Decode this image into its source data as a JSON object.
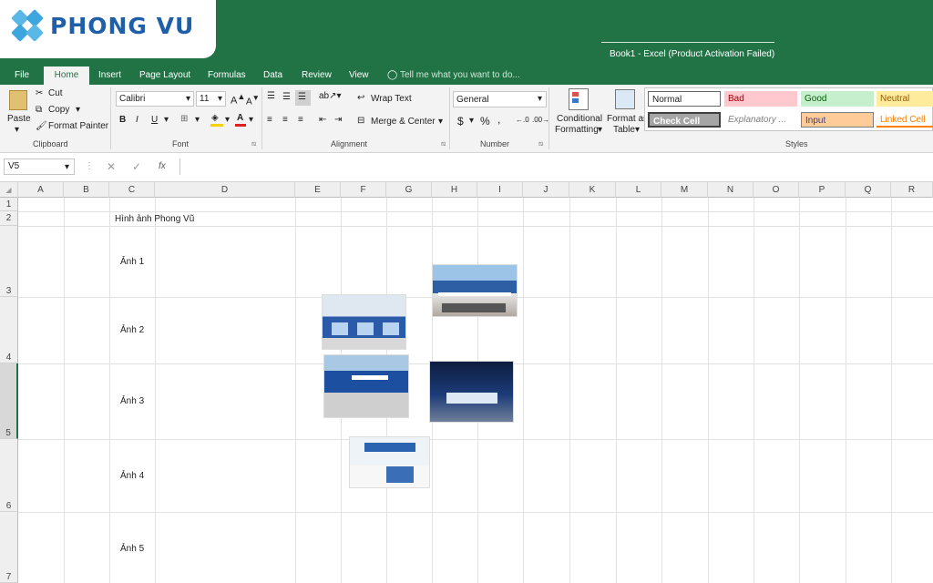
{
  "brand": {
    "logo_text": "PHONG VU"
  },
  "window": {
    "title": "Book1 - Excel (Product Activation Failed)"
  },
  "menu": {
    "tabs": [
      "File",
      "Home",
      "Insert",
      "Page Layout",
      "Formulas",
      "Data",
      "Review",
      "View"
    ],
    "tell_me": "Tell me what you want to do..."
  },
  "ribbon": {
    "clipboard": {
      "paste": "Paste",
      "cut": "Cut",
      "copy": "Copy",
      "format_painter": "Format Painter",
      "group": "Clipboard"
    },
    "font": {
      "name": "Calibri",
      "size": "11",
      "group": "Font"
    },
    "alignment": {
      "wrap_text": "Wrap Text",
      "merge_center": "Merge & Center",
      "group": "Alignment"
    },
    "number": {
      "format": "General",
      "group": "Number"
    },
    "styles": {
      "conditional_formatting_1": "Conditional",
      "conditional_formatting_2": "Formatting",
      "format_as_table_1": "Format as",
      "format_as_table_2": "Table",
      "normal": "Normal",
      "bad": "Bad",
      "good": "Good",
      "neutral": "Neutral",
      "check_cell": "Check Cell",
      "explanatory": "Explanatory ...",
      "input": "Input",
      "linked_cell": "Linked Cell",
      "group": "Styles"
    }
  },
  "formula_bar": {
    "name_box": "V5",
    "fx": "fx",
    "content": ""
  },
  "columns": [
    "A",
    "B",
    "C",
    "D",
    "E",
    "F",
    "G",
    "H",
    "I",
    "J",
    "K",
    "L",
    "M",
    "N",
    "O",
    "P",
    "Q",
    "R"
  ],
  "rows": [
    "1",
    "2",
    "3",
    "4",
    "5",
    "6",
    "7"
  ],
  "cells": {
    "c2": "Hình ảnh Phong Vũ",
    "c3": "Ảnh 1",
    "c4": "Ảnh 2",
    "c5": "Ảnh 3",
    "c6": "Ảnh 4",
    "c7": "Ảnh 5"
  },
  "colors": {
    "excel_green": "#217346",
    "logo_blue": "#1f5fa8",
    "logo_light": "#5ab8e6"
  }
}
